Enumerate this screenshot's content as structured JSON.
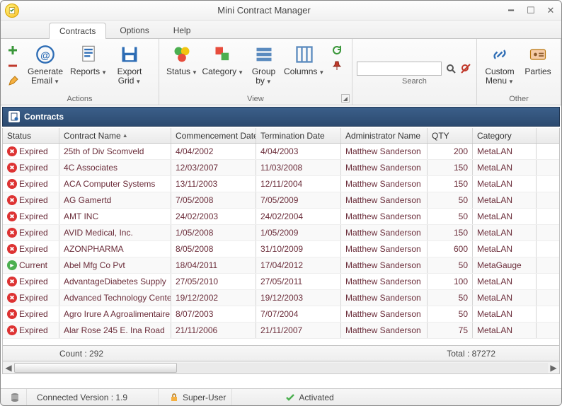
{
  "app": {
    "title": "Mini Contract Manager"
  },
  "tabs": {
    "contracts": "Contracts",
    "options": "Options",
    "help": "Help"
  },
  "ribbon": {
    "actions": {
      "label": "Actions",
      "generate_email": "Generate\nEmail",
      "reports": "Reports",
      "export_grid": "Export\nGrid"
    },
    "view": {
      "label": "View",
      "status": "Status",
      "category": "Category",
      "group_by": "Group\nby",
      "columns": "Columns"
    },
    "search": {
      "label": "Search",
      "placeholder": ""
    },
    "other": {
      "label": "Other",
      "custom_menu": "Custom\nMenu",
      "parties": "Parties"
    }
  },
  "panel": {
    "title": "Contracts"
  },
  "grid": {
    "headers": {
      "status": "Status",
      "contract_name": "Contract Name",
      "commencement": "Commencement Date",
      "termination": "Termination Date",
      "admin": "Administrator Name",
      "qty": "QTY",
      "category": "Category"
    },
    "rows": [
      {
        "status": "Expired",
        "name": "25th of Div Scomveld",
        "comm": "4/04/2002",
        "term": "4/04/2003",
        "admin": "Matthew Sanderson",
        "qty": "200",
        "cat": "MetaLAN"
      },
      {
        "status": "Expired",
        "name": "4C Associates",
        "comm": "12/03/2007",
        "term": "11/03/2008",
        "admin": "Matthew Sanderson",
        "qty": "150",
        "cat": "MetaLAN"
      },
      {
        "status": "Expired",
        "name": "ACA Computer Systems",
        "comm": "13/11/2003",
        "term": "12/11/2004",
        "admin": "Matthew Sanderson",
        "qty": "150",
        "cat": "MetaLAN"
      },
      {
        "status": "Expired",
        "name": "AG Gamertd",
        "comm": "7/05/2008",
        "term": "7/05/2009",
        "admin": "Matthew Sanderson",
        "qty": "50",
        "cat": "MetaLAN"
      },
      {
        "status": "Expired",
        "name": "AMT INC",
        "comm": "24/02/2003",
        "term": "24/02/2004",
        "admin": "Matthew Sanderson",
        "qty": "50",
        "cat": "MetaLAN"
      },
      {
        "status": "Expired",
        "name": "AVID Medical, Inc.",
        "comm": "1/05/2008",
        "term": "1/05/2009",
        "admin": "Matthew Sanderson",
        "qty": "150",
        "cat": "MetaLAN"
      },
      {
        "status": "Expired",
        "name": "AZONPHARMA",
        "comm": "8/05/2008",
        "term": "31/10/2009",
        "admin": "Matthew Sanderson",
        "qty": "600",
        "cat": "MetaLAN"
      },
      {
        "status": "Current",
        "name": "Abel Mfg Co Pvt",
        "comm": "18/04/2011",
        "term": "17/04/2012",
        "admin": "Matthew Sanderson",
        "qty": "50",
        "cat": "MetaGauge"
      },
      {
        "status": "Expired",
        "name": "AdvantageDiabetes Supply",
        "comm": "27/05/2010",
        "term": "27/05/2011",
        "admin": "Matthew Sanderson",
        "qty": "100",
        "cat": "MetaLAN"
      },
      {
        "status": "Expired",
        "name": "Advanced Technology Center,",
        "comm": "19/12/2002",
        "term": "19/12/2003",
        "admin": "Matthew Sanderson",
        "qty": "50",
        "cat": "MetaLAN"
      },
      {
        "status": "Expired",
        "name": "Agro Irure A Agroalimentaire",
        "comm": "8/07/2003",
        "term": "7/07/2004",
        "admin": "Matthew Sanderson",
        "qty": "50",
        "cat": "MetaLAN"
      },
      {
        "status": "Expired",
        "name": "Alar Rose 245 E. Ina Road",
        "comm": "21/11/2006",
        "term": "21/11/2007",
        "admin": "Matthew Sanderson",
        "qty": "75",
        "cat": "MetaLAN"
      }
    ],
    "footer": {
      "count_label": "Count : 292",
      "total_label": "Total : 87272"
    }
  },
  "statusbar": {
    "version": "Connected Version : 1.9",
    "role": "Super-User",
    "activation": "Activated"
  }
}
